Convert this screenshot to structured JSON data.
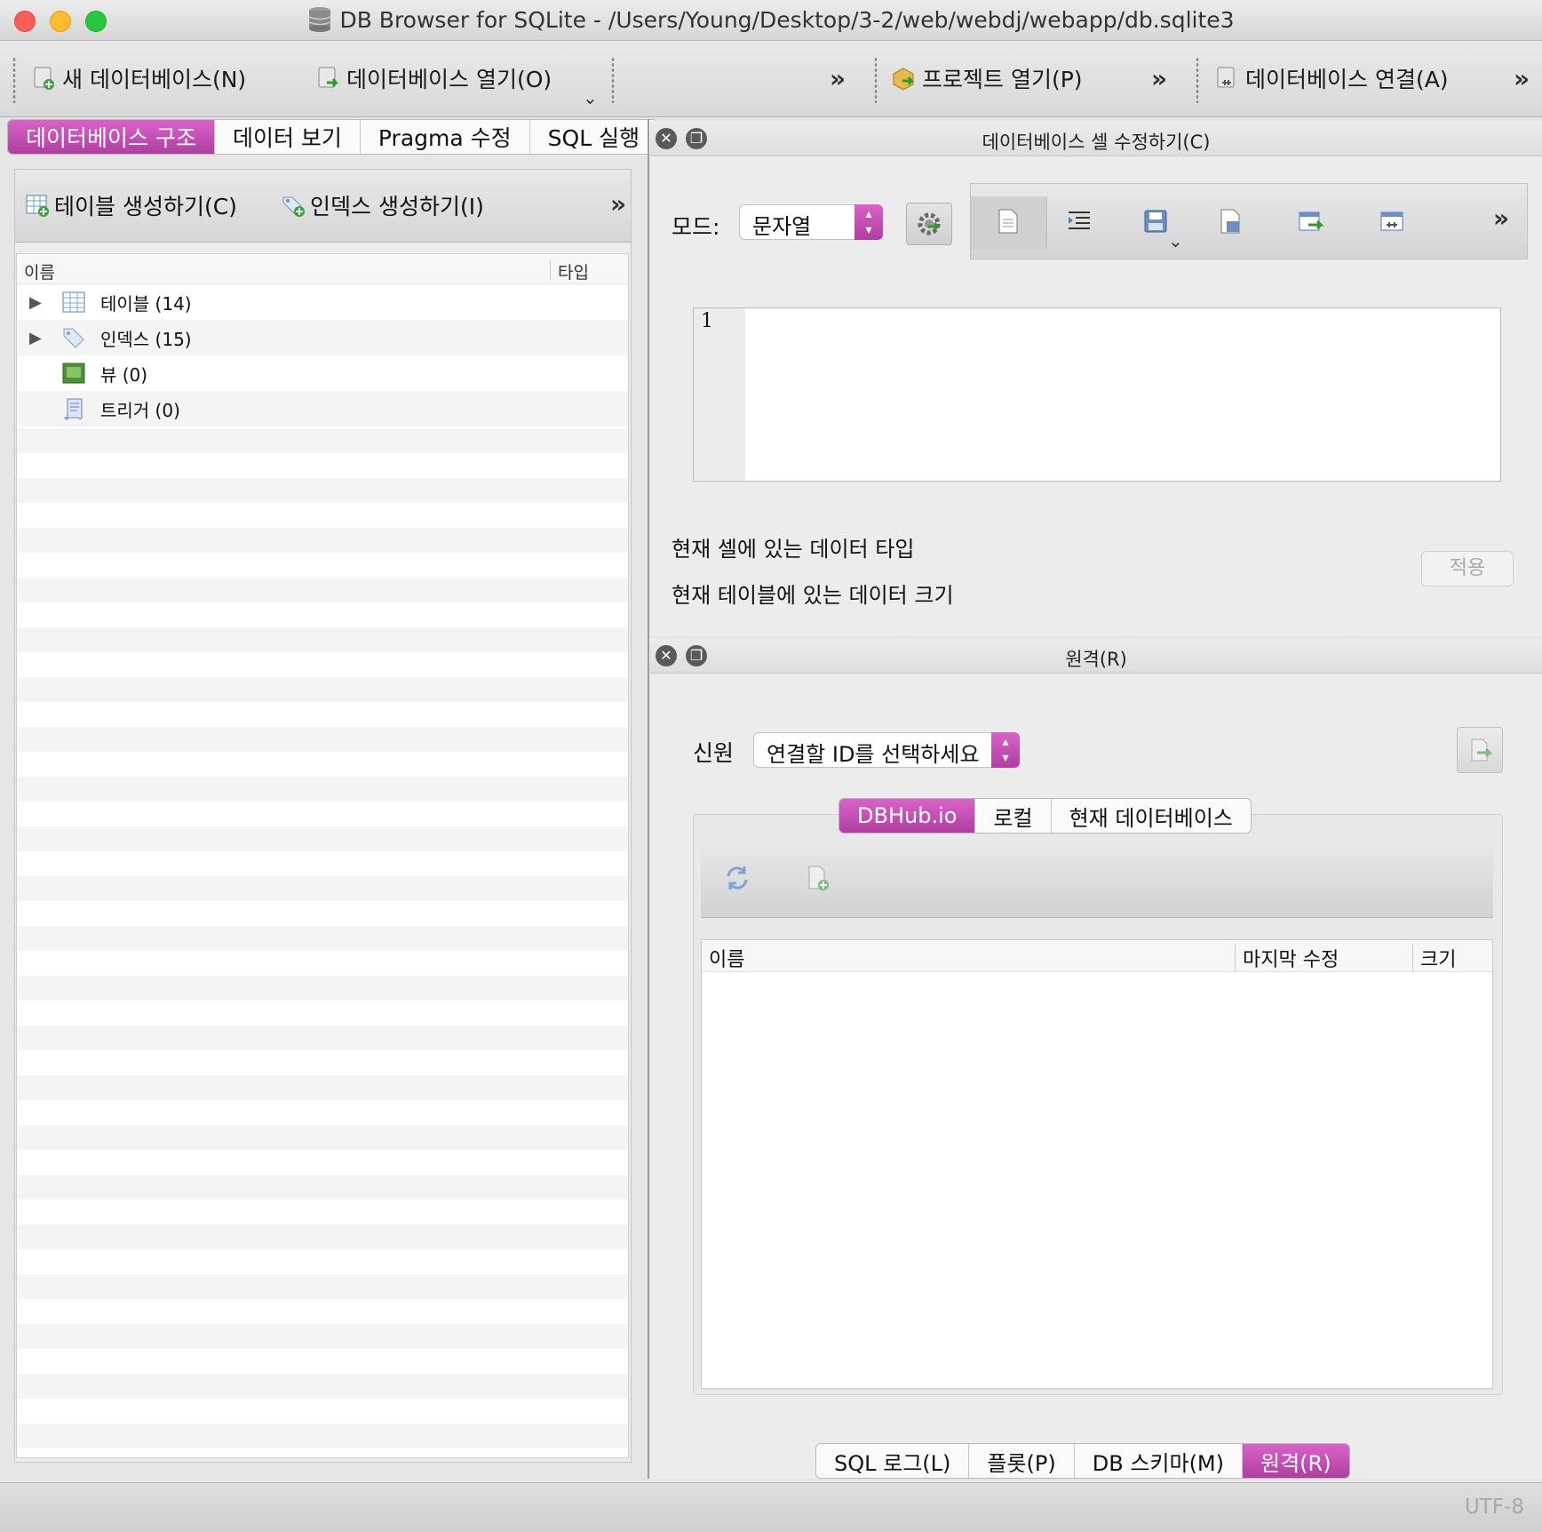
{
  "window": {
    "title": "DB Browser for SQLite - /Users/Young/Desktop/3-2/web/webdj/webapp/db.sqlite3"
  },
  "toolbar": {
    "new_db": "새 데이터베이스(N)",
    "open_db": "데이터베이스 열기(O)",
    "open_project": "프로젝트 열기(P)",
    "attach_db": "데이터베이스 연결(A)",
    "more": "»"
  },
  "left_tabs": [
    "데이터베이스 구조",
    "데이터 보기",
    "Pragma 수정",
    "SQL 실행"
  ],
  "structure": {
    "create_table": "테이블 생성하기(C)",
    "create_index": "인덱스 생성하기(I)",
    "columns": {
      "name": "이름",
      "type": "타입"
    },
    "items": [
      {
        "label": "테이블 (14)",
        "icon": "table-icon",
        "expandable": true
      },
      {
        "label": "인덱스 (15)",
        "icon": "index-tag-icon",
        "expandable": true
      },
      {
        "label": "뷰 (0)",
        "icon": "view-icon",
        "expandable": false
      },
      {
        "label": "트리거 (0)",
        "icon": "trigger-icon",
        "expandable": false
      }
    ]
  },
  "edit_cell": {
    "title": "데이터베이스 셀 수정하기(C)",
    "mode_label": "모드:",
    "mode_value": "문자열",
    "line_number": "1",
    "type_info": "현재 셀에 있는 데이터 타입",
    "size_info": "현재 테이블에 있는 데이터 크기",
    "apply": "적용"
  },
  "remote": {
    "title": "원격(R)",
    "identity_label": "신원",
    "identity_placeholder": "연결할 ID를 선택하세요",
    "tabs": [
      "DBHub.io",
      "로컬",
      "현재 데이터베이스"
    ],
    "columns": {
      "name": "이름",
      "modified": "마지막 수정",
      "size": "크기"
    }
  },
  "bottom_tabs": [
    "SQL 로그(L)",
    "플롯(P)",
    "DB 스키마(M)",
    "원격(R)"
  ],
  "status": {
    "encoding": "UTF-8"
  },
  "colors": {
    "accent": "#c24db5"
  }
}
